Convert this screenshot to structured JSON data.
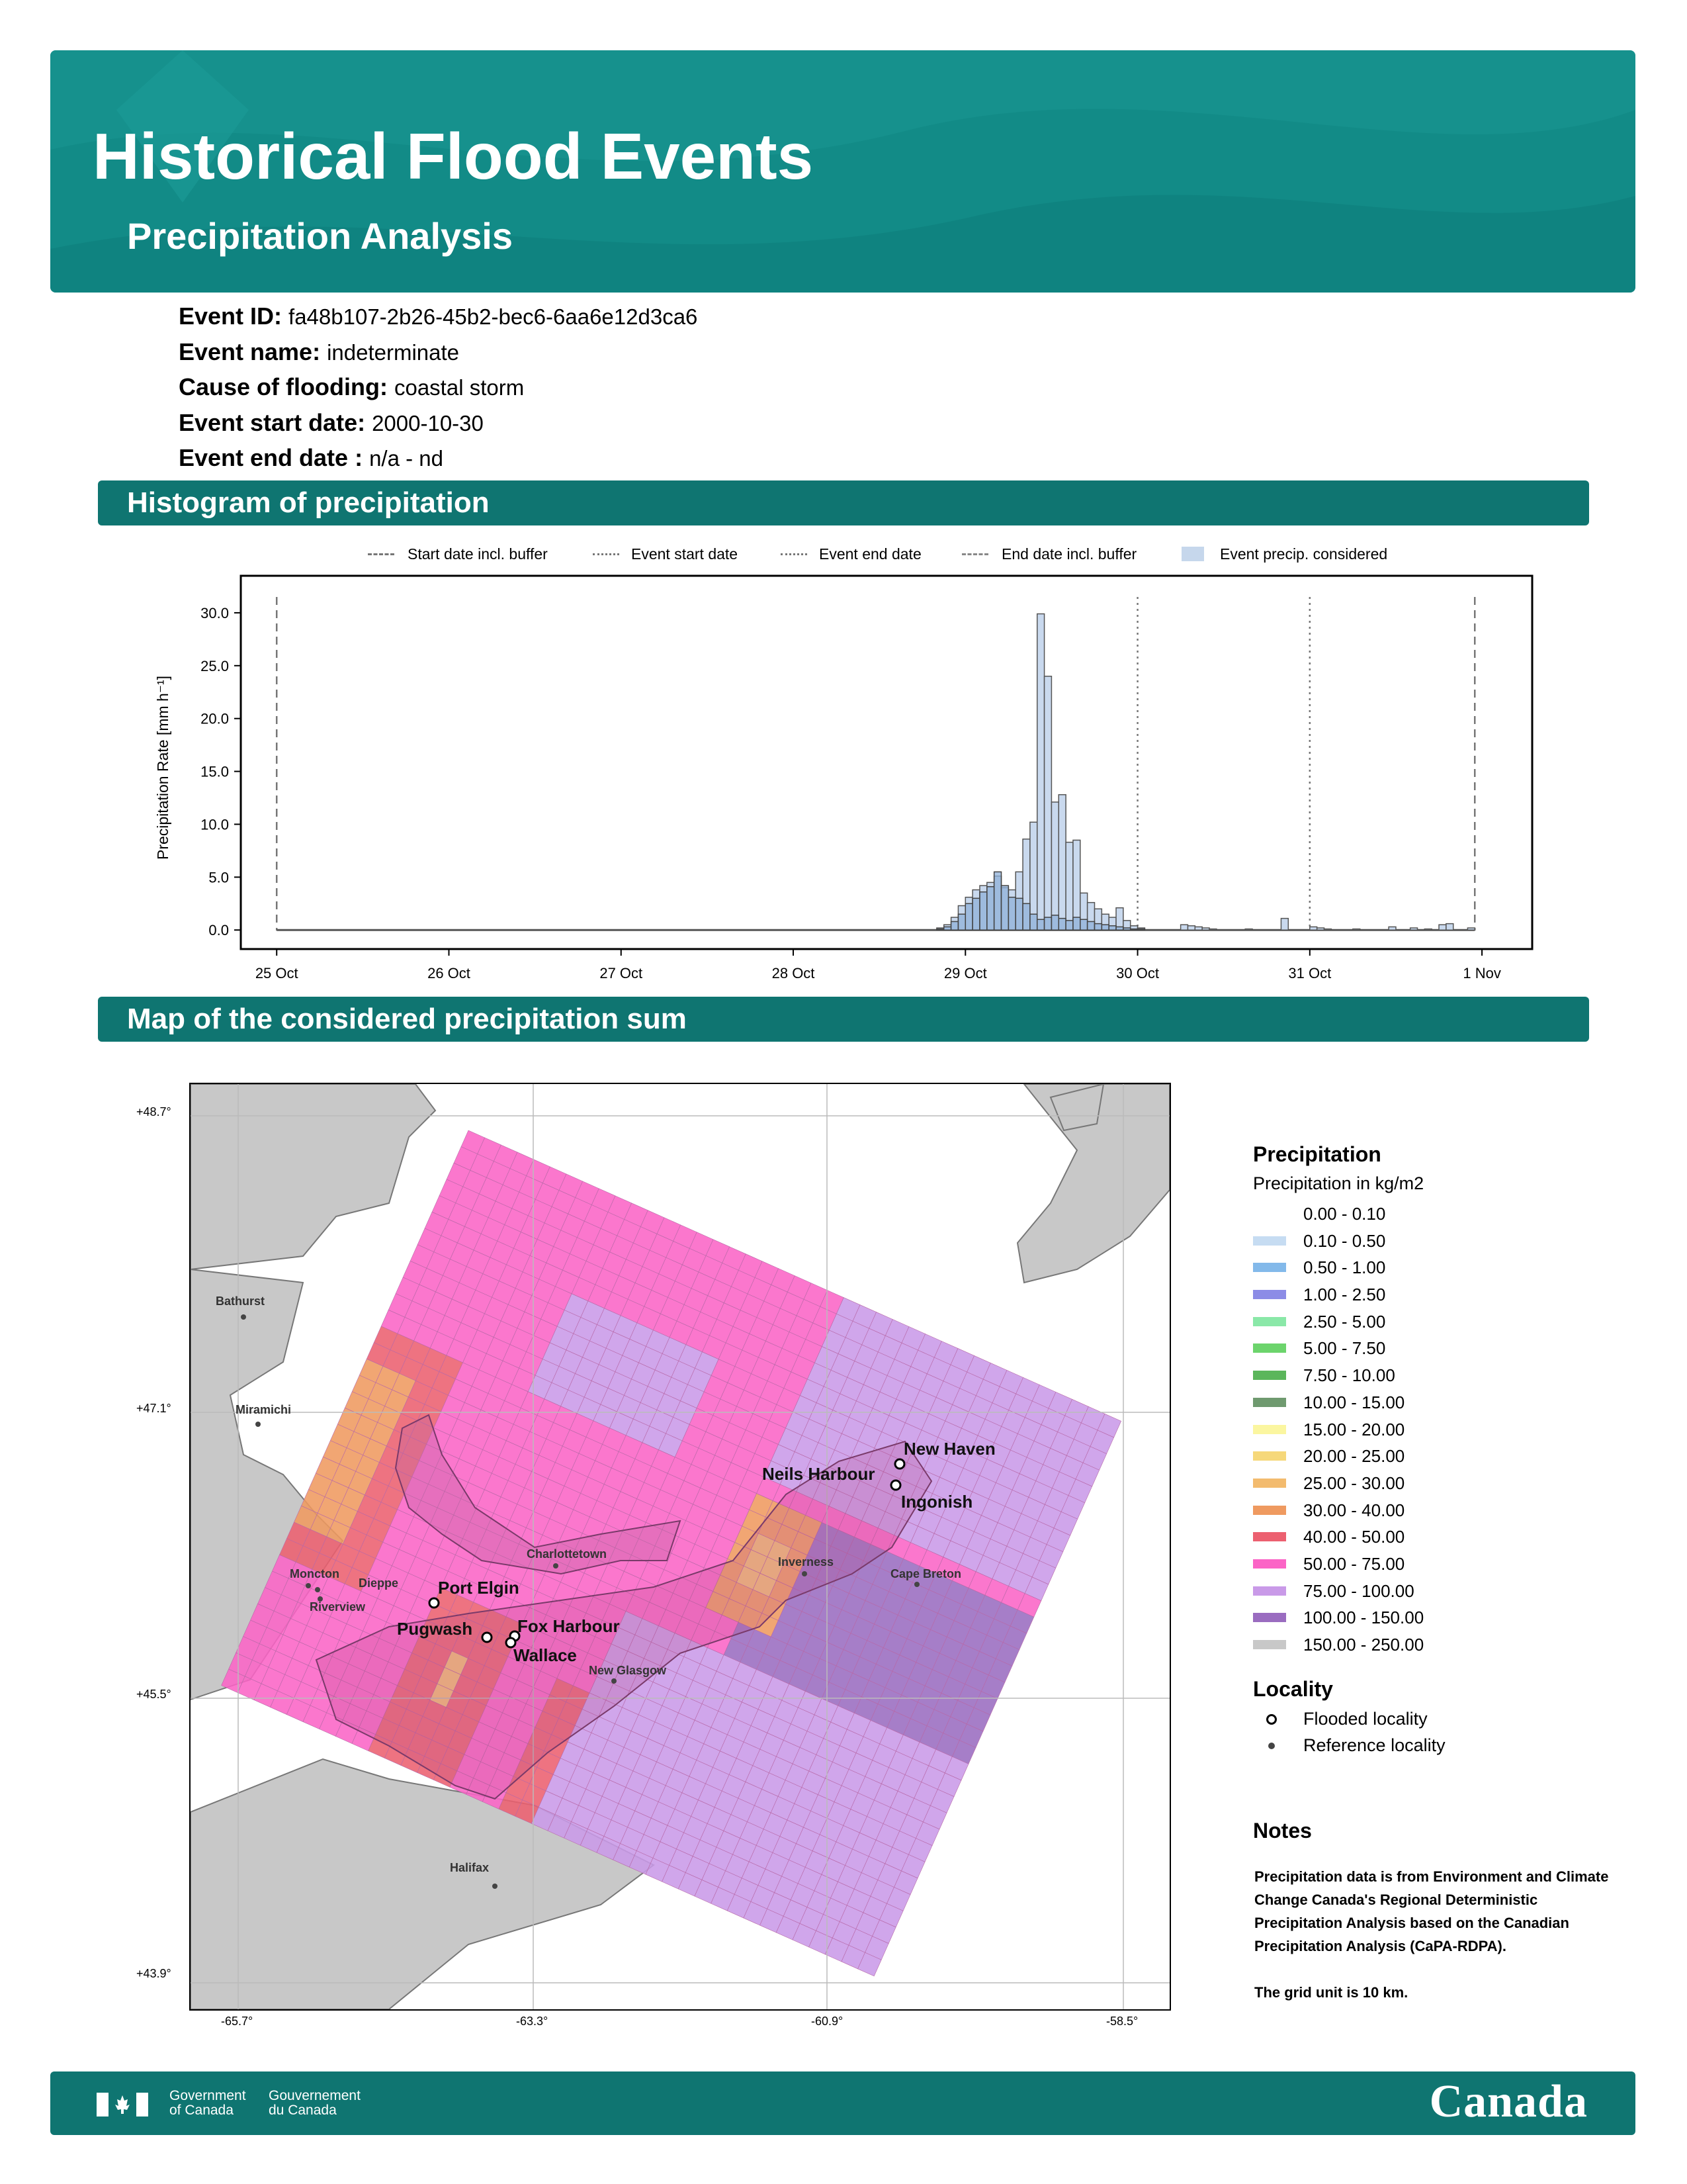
{
  "header": {
    "title": "Historical Flood Events",
    "subtitle": "Precipitation Analysis"
  },
  "event": {
    "id_label": "Event ID:",
    "id_value": "fa48b107-2b26-45b2-bec6-6aa6e12d3ca6",
    "name_label": "Event name:",
    "name_value": "indeterminate",
    "cause_label": "Cause of flooding:",
    "cause_value": "coastal storm",
    "start_label": "Event start date:",
    "start_value": "2000-10-30",
    "end_label": "Event end date :",
    "end_value": "n/a - nd"
  },
  "sections": {
    "histogram": "Histogram of precipitation",
    "map": "Map of the considered precipitation sum"
  },
  "chart_legend": {
    "start_buffer": "Start date incl. buffer",
    "event_start": "Event start date",
    "event_end": "Event end date",
    "end_buffer": "End date incl. buffer",
    "considered": "Event precip. considered"
  },
  "chart_data": {
    "type": "bar",
    "ylabel": "Precipitation Rate [mm h⁻¹]",
    "ylim": [
      -1.8,
      33.5
    ],
    "yticks": [
      "0.0",
      "5.0",
      "10.0",
      "15.0",
      "20.0",
      "25.0",
      "30.0"
    ],
    "xticks": [
      "25 Oct",
      "26 Oct",
      "27 Oct",
      "28 Oct",
      "29 Oct",
      "30 Oct",
      "31 Oct",
      "1 Nov"
    ],
    "x_unit": "hours from 25 Oct 00:00",
    "xlim": [
      -5,
      175
    ],
    "vlines": {
      "start_buffer": 0,
      "event_start": 120,
      "event_end": 144,
      "end_buffer": 167
    },
    "series": [
      {
        "name": "Event precip. considered",
        "x": [
          92,
          93,
          94,
          95,
          96,
          97,
          98,
          99,
          100,
          101,
          102,
          103,
          104,
          105,
          106,
          107,
          108,
          109,
          110,
          111,
          112,
          113,
          114,
          115,
          116,
          117,
          118,
          119,
          120,
          126,
          127,
          128,
          129,
          130,
          135,
          140,
          144,
          145,
          146,
          150,
          155,
          158,
          160,
          162,
          163,
          166
        ],
        "values": [
          0.2,
          0.5,
          1.2,
          2.3,
          3.1,
          3.8,
          4.2,
          4.5,
          5.1,
          4.0,
          3.8,
          5.5,
          8.6,
          10.2,
          29.9,
          24.0,
          12.1,
          12.8,
          8.3,
          8.5,
          3.5,
          2.6,
          2.0,
          1.5,
          1.2,
          2.1,
          0.9,
          0.4,
          0.2,
          0.5,
          0.4,
          0.3,
          0.2,
          0.1,
          0.1,
          1.1,
          0.3,
          0.2,
          0.1,
          0.1,
          0.3,
          0.2,
          0.1,
          0.5,
          0.6,
          0.2
        ]
      },
      {
        "name": "",
        "x": [
          92,
          93,
          94,
          95,
          96,
          97,
          98,
          99,
          100,
          101,
          102,
          103,
          104,
          105,
          106,
          107,
          108,
          109,
          110,
          111,
          112,
          113,
          114,
          115,
          116,
          117,
          118,
          119,
          120
        ],
        "values": [
          0.1,
          0.3,
          0.8,
          1.5,
          2.5,
          3.0,
          3.6,
          4.1,
          5.5,
          4.2,
          3.1,
          3.0,
          2.5,
          1.5,
          1.0,
          1.2,
          1.4,
          1.1,
          0.9,
          1.2,
          1.0,
          0.8,
          0.6,
          0.5,
          0.4,
          0.3,
          0.2,
          0.1,
          0.1
        ]
      }
    ]
  },
  "map": {
    "lat_ticks": [
      "+48.7°",
      "+47.1°",
      "+45.5°",
      "+43.9°"
    ],
    "lon_ticks": [
      "-65.7°",
      "-63.3°",
      "-60.9°",
      "-58.5°"
    ],
    "flooded": [
      "New Haven",
      "Neils Harbour",
      "Ingonish",
      "Port Elgin",
      "Pugwash",
      "Fox Harbour",
      "Wallace"
    ],
    "reference": [
      "Bathurst",
      "Miramichi",
      "Charlottetown",
      "Inverness",
      "Cape Breton",
      "Moncton",
      "Dieppe",
      "Riverview",
      "New Glasgow",
      "Halifax"
    ]
  },
  "map_legend": {
    "title": "Precipitation",
    "subtitle": "Precipitation in kg/m2",
    "classes": [
      {
        "label": "0.00 - 0.10",
        "color": "#ffffff"
      },
      {
        "label": "0.10 - 0.50",
        "color": "#c6dcf2"
      },
      {
        "label": "0.50 - 1.00",
        "color": "#83b9ea"
      },
      {
        "label": "1.00 - 2.50",
        "color": "#8c8ce6"
      },
      {
        "label": "2.50 - 5.00",
        "color": "#8ae8a8"
      },
      {
        "label": "5.00 - 7.50",
        "color": "#6cd46c"
      },
      {
        "label": "7.50 - 10.00",
        "color": "#5bb65b"
      },
      {
        "label": "10.00 - 15.00",
        "color": "#6f9a6f"
      },
      {
        "label": "15.00 - 20.00",
        "color": "#fbf6a0"
      },
      {
        "label": "20.00 - 25.00",
        "color": "#f6d87a"
      },
      {
        "label": "25.00 - 30.00",
        "color": "#f3bb6e"
      },
      {
        "label": "30.00 - 40.00",
        "color": "#ef9a60"
      },
      {
        "label": "40.00 - 50.00",
        "color": "#ec6070"
      },
      {
        "label": "50.00 - 75.00",
        "color": "#fb64c6"
      },
      {
        "label": "75.00 - 100.00",
        "color": "#c99ae8"
      },
      {
        "label": "100.00 - 150.00",
        "color": "#9a6cc0"
      },
      {
        "label": "150.00 - 250.00",
        "color": "#c8c8c8"
      }
    ],
    "locality_title": "Locality",
    "flooded_label": "Flooded locality",
    "reference_label": "Reference locality"
  },
  "notes": {
    "title": "Notes",
    "text1": "Precipitation data is from Environment and Climate Change Canada's Regional Deterministic Precipitation Analysis based on the Canadian Precipitation Analysis (CaPA-RDPA).",
    "text2": "The grid unit is 10 km."
  },
  "footer": {
    "gov_en_1": "Government",
    "gov_en_2": "of Canada",
    "gov_fr_1": "Gouvernement",
    "gov_fr_2": "du Canada",
    "wordmark": "Canada"
  }
}
